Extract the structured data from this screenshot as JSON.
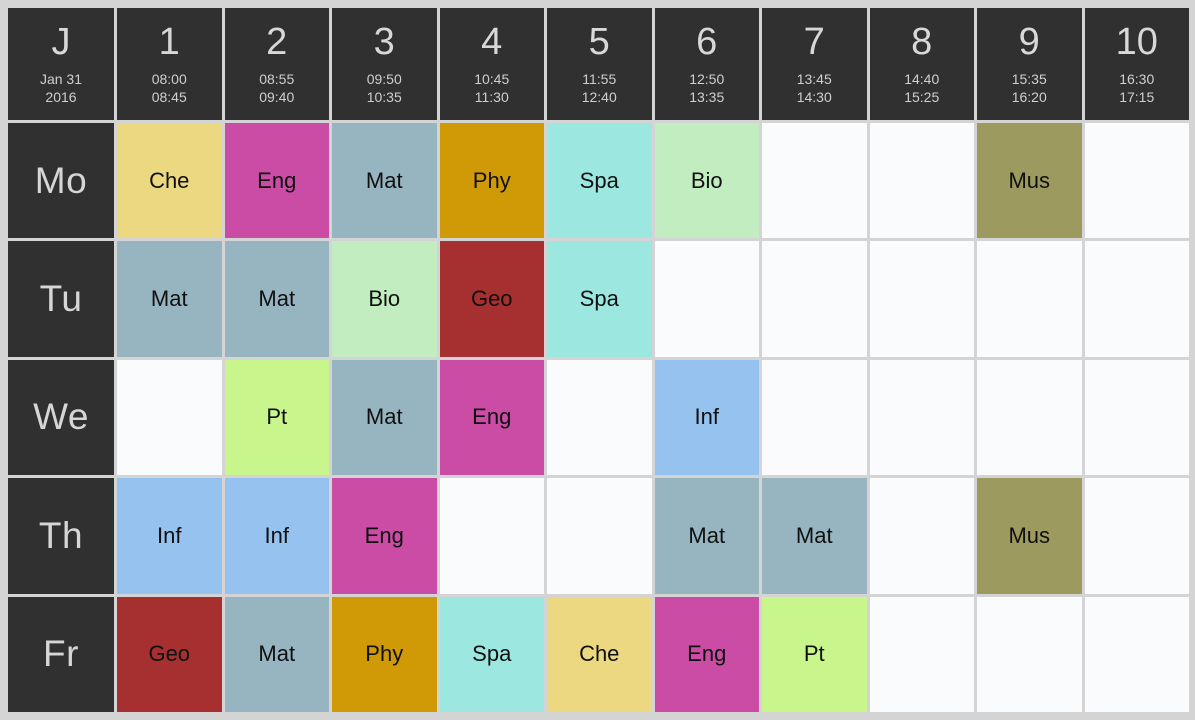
{
  "header": {
    "corner": {
      "label": "J",
      "date_line1": "Jan 31",
      "date_line2": "2016"
    },
    "periods": [
      {
        "num": "1",
        "start": "08:00",
        "end": "08:45"
      },
      {
        "num": "2",
        "start": "08:55",
        "end": "09:40"
      },
      {
        "num": "3",
        "start": "09:50",
        "end": "10:35"
      },
      {
        "num": "4",
        "start": "10:45",
        "end": "11:30"
      },
      {
        "num": "5",
        "start": "11:55",
        "end": "12:40"
      },
      {
        "num": "6",
        "start": "12:50",
        "end": "13:35"
      },
      {
        "num": "7",
        "start": "13:45",
        "end": "14:30"
      },
      {
        "num": "8",
        "start": "14:40",
        "end": "15:25"
      },
      {
        "num": "9",
        "start": "15:35",
        "end": "16:20"
      },
      {
        "num": "10",
        "start": "16:30",
        "end": "17:15"
      }
    ]
  },
  "subject_colors": {
    "Che": "#edd882",
    "Eng": "#cb4ca4",
    "Mat": "#96b5c1",
    "Phy": "#d09a06",
    "Spa": "#9ce8e1",
    "Bio": "#c2edc0",
    "Mus": "#9c9a5e",
    "Geo": "#a6302f",
    "Inf": "#96c2f0",
    "Pt": "#c8f68d",
    "empty": "#fafbfd"
  },
  "days": [
    {
      "label": "Mo",
      "lessons": [
        "Che",
        "Eng",
        "Mat",
        "Phy",
        "Spa",
        "Bio",
        "",
        "",
        "Mus",
        ""
      ]
    },
    {
      "label": "Tu",
      "lessons": [
        "Mat",
        "Mat",
        "Bio",
        "Geo",
        "Spa",
        "",
        "",
        "",
        "",
        ""
      ]
    },
    {
      "label": "We",
      "lessons": [
        "",
        "Pt",
        "Mat",
        "Eng",
        "",
        "Inf",
        "",
        "",
        "",
        ""
      ]
    },
    {
      "label": "Th",
      "lessons": [
        "Inf",
        "Inf",
        "Eng",
        "",
        "",
        "Mat",
        "Mat",
        "",
        "Mus",
        ""
      ]
    },
    {
      "label": "Fr",
      "lessons": [
        "Geo",
        "Mat",
        "Phy",
        "Spa",
        "Che",
        "Eng",
        "Pt",
        "",
        "",
        ""
      ]
    }
  ]
}
